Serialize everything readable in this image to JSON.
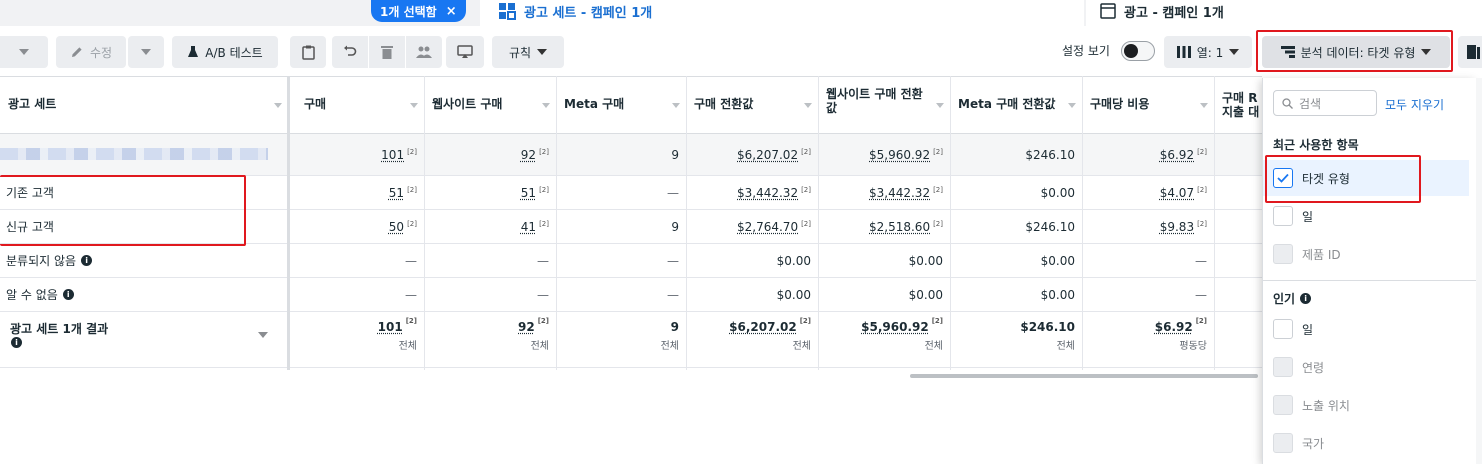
{
  "tabs": {
    "selected_pill": "1개 선택함",
    "pill_close": "×",
    "adsets_tab": "광고 세트 - 캠페인 1개",
    "ads_tab": "광고 - 캠페인 1개"
  },
  "toolbar": {
    "edit_label": "수정",
    "ab_test_label": "A/B 테스트",
    "rules_label": "규칙",
    "view_settings_label": "설정 보기",
    "columns_label": "열: 1",
    "breakdown_label": "분석 데이터: 타겟 유형"
  },
  "table": {
    "headers": [
      "광고 세트",
      "구매",
      "웹사이트 구매",
      "Meta 구매",
      "구매 전환값",
      "웹사이트 구매 전환값",
      "Meta 구매 전환값",
      "구매당 비용",
      "구매 R\n지출 대"
    ],
    "rows": [
      {
        "name": "",
        "values": [
          "101",
          "92",
          "9",
          "$6,207.02",
          "$5,960.92",
          "$246.10",
          "$6.92"
        ]
      },
      {
        "name": "기존 고객",
        "values": [
          "51",
          "51",
          "—",
          "$3,442.32",
          "$3,442.32",
          "$0.00",
          "$4.07"
        ]
      },
      {
        "name": "신규 고객",
        "values": [
          "50",
          "41",
          "9",
          "$2,764.70",
          "$2,518.60",
          "$246.10",
          "$9.83"
        ]
      },
      {
        "name": "분류되지 않음",
        "values": [
          "—",
          "—",
          "—",
          "$0.00",
          "$0.00",
          "$0.00",
          "—"
        ]
      },
      {
        "name": "알 수 없음",
        "values": [
          "—",
          "—",
          "—",
          "$0.00",
          "$0.00",
          "$0.00",
          "—"
        ]
      }
    ],
    "sup_mark": "[2]",
    "total": {
      "label": "광고 세트 1개 결과",
      "values": [
        "101",
        "92",
        "9",
        "$6,207.02",
        "$5,960.92",
        "$246.10",
        "$6.92"
      ],
      "subs": [
        "전체",
        "전체",
        "전체",
        "전체",
        "전체",
        "전체",
        "평동당"
      ]
    }
  },
  "panel": {
    "search_placeholder": "검색",
    "clear_all": "모두 지우기",
    "recent_title": "최근 사용한 항목",
    "recent_items": [
      {
        "label": "타겟 유형",
        "checked": true
      },
      {
        "label": "일",
        "checked": false
      },
      {
        "label": "제품 ID",
        "checked": false,
        "disabled": true
      }
    ],
    "popular_title": "인기",
    "popular_items": [
      {
        "label": "일",
        "checked": false
      },
      {
        "label": "연령",
        "checked": false,
        "disabled": true
      },
      {
        "label": "노출 위치",
        "checked": false,
        "disabled": true
      },
      {
        "label": "국가",
        "checked": false,
        "disabled": true
      }
    ]
  },
  "colors": {
    "accent": "#1877f2",
    "highlight": "#e0181e",
    "link": "#1a6fd1"
  }
}
